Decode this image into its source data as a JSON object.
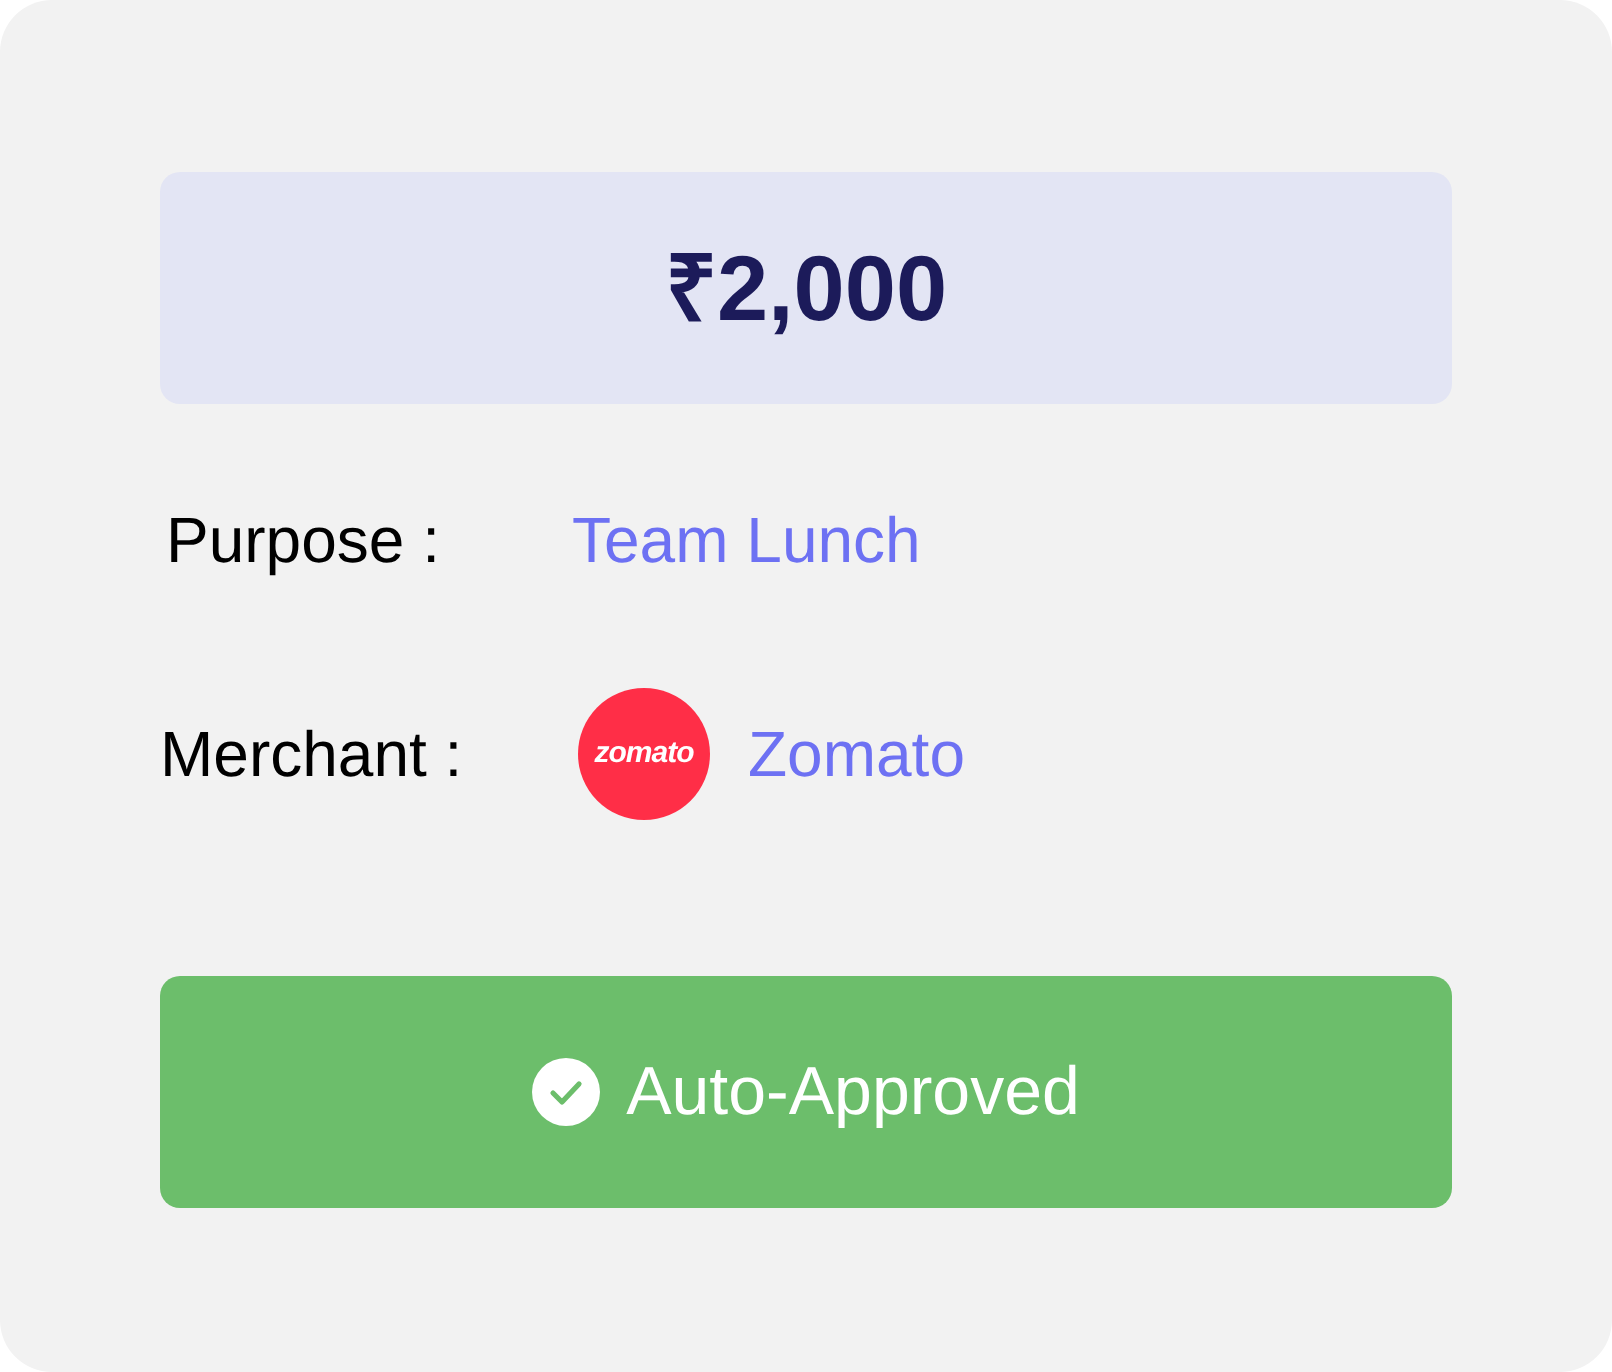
{
  "amount": "₹2,000",
  "details": [
    {
      "kind": "text",
      "label": "Purpose :",
      "value": "Team Lunch"
    },
    {
      "kind": "merchant",
      "label": "Merchant :",
      "logo_text": "zomato",
      "value": "Zomato"
    }
  ],
  "status": {
    "kind": "approved",
    "label": "Auto-Approved"
  }
}
